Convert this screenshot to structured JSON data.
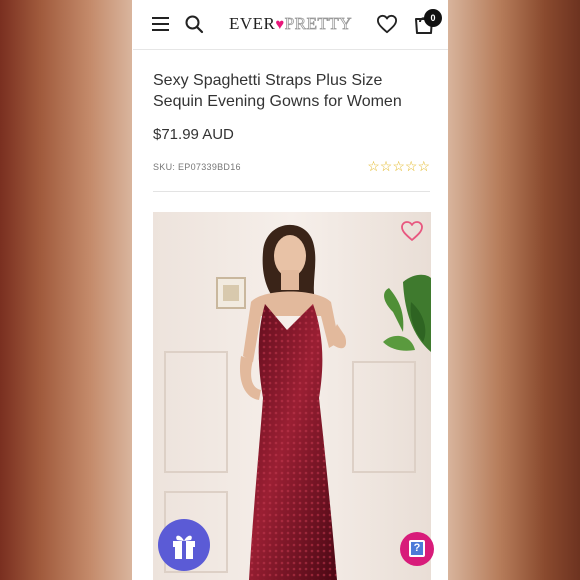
{
  "header": {
    "logo_ever": "EVER",
    "logo_heart": "♥",
    "logo_pretty": "PRETTY",
    "cart_count": "0"
  },
  "product": {
    "title": "Sexy Spaghetti Straps Plus Size Sequin Evening Gowns for Women",
    "price": "$71.99 AUD",
    "sku_label": "SKU:",
    "sku": "EP07339BD16",
    "rating_stars": "☆☆☆☆☆",
    "rating": 0
  },
  "help": {
    "label": "?"
  },
  "colors": {
    "accent_pink": "#e8177a",
    "gift_button": "#5b5bd6",
    "help_button": "#d81b7a",
    "star": "#e3b824",
    "dress": "#7d1226"
  },
  "icons": [
    "hamburger-icon",
    "search-icon",
    "heart-icon",
    "cart-icon",
    "gift-icon",
    "question-icon"
  ]
}
